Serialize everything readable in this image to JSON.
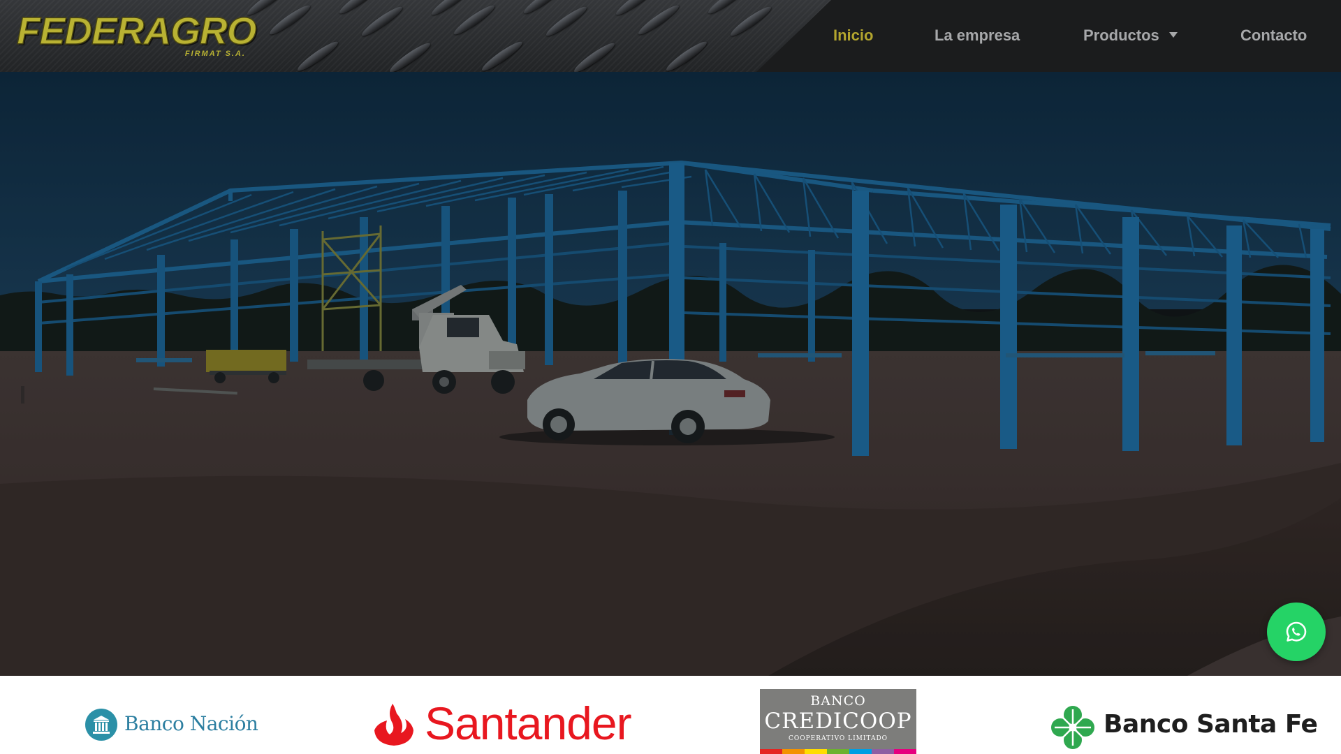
{
  "header": {
    "logo": {
      "name": "FEDERAGRO",
      "subtitle": "FIRMAT S.A.",
      "color": "#b9b233"
    },
    "nav": {
      "items": [
        {
          "label": "Inicio",
          "active": true
        },
        {
          "label": "La empresa",
          "active": false
        },
        {
          "label": "Productos",
          "active": false,
          "has_dropdown": true,
          "icon": "caret-down-icon"
        },
        {
          "label": "Contacto",
          "active": false
        }
      ],
      "active_color": "#b3a52e",
      "color": "#a7a8aa"
    }
  },
  "hero": {
    "image": "steel-warehouse-structure-construction-photo",
    "overlay_color": "#0b1822"
  },
  "whatsapp": {
    "icon": "whatsapp-icon",
    "color": "#25d366"
  },
  "banks": [
    {
      "name": "Banco Nación",
      "icon": "bank-building-icon",
      "color": "#2b7ea0"
    },
    {
      "name": "Santander",
      "icon": "flame-icon",
      "color": "#e8171f"
    },
    {
      "top": "BANCO",
      "name": "CREDICOOP",
      "sub": "COOPERATIVO LIMITADO",
      "stripe_colors": [
        "#e52521",
        "#f39200",
        "#ffdd00",
        "#6cb22e",
        "#009fe3",
        "#8e5ea2",
        "#e6007e"
      ]
    },
    {
      "name": "Banco Santa Fe",
      "icon": "clover-icon",
      "color": "#2fa84f"
    }
  ]
}
